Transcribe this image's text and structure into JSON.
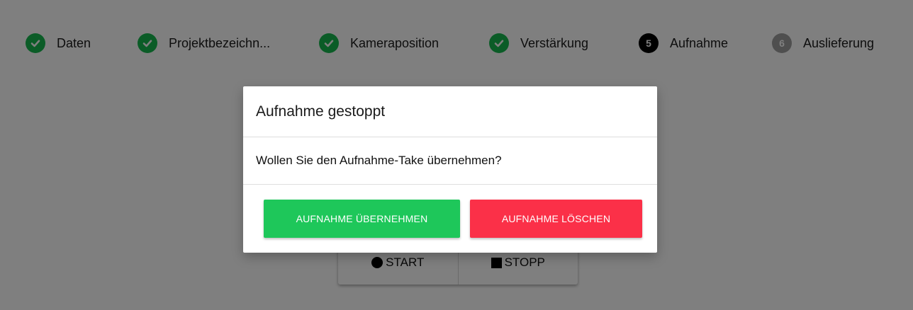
{
  "stepper": {
    "steps": [
      {
        "label": "Daten",
        "state": "done",
        "number": ""
      },
      {
        "label": "Projektbezeichn...",
        "state": "done",
        "number": ""
      },
      {
        "label": "Kameraposition",
        "state": "done",
        "number": ""
      },
      {
        "label": "Verstärkung",
        "state": "done",
        "number": ""
      },
      {
        "label": "Aufnahme",
        "state": "active",
        "number": "5"
      },
      {
        "label": "Auslieferung",
        "state": "todo",
        "number": "6"
      }
    ]
  },
  "controls": {
    "start_label": "START",
    "stop_label": "STOPP"
  },
  "modal": {
    "title": "Aufnahme gestoppt",
    "message": "Wollen Sie den Aufnahme-Take übernehmen?",
    "accept_label": "AUFNAHME ÜBERNEHMEN",
    "delete_label": "AUFNAHME LÖSCHEN"
  },
  "colors": {
    "success": "#1ec75a",
    "danger": "#fb3048",
    "step_done": "#16b84e",
    "step_active": "#000000",
    "step_todo": "#9e9e9e",
    "overlay": "rgba(0,0,0,0.5)"
  },
  "icons": {
    "done": "check-icon",
    "start": "record-dot-icon",
    "stop": "stop-square-icon"
  }
}
